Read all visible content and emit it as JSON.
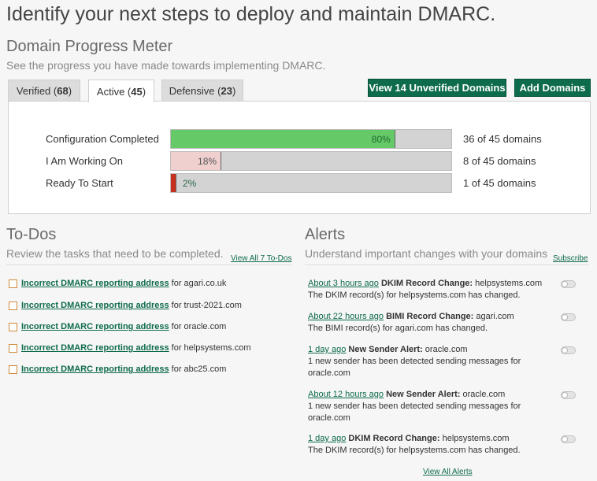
{
  "page_title": "Identify your next steps to deploy and maintain DMARC.",
  "progress_meter": {
    "title": "Domain Progress Meter",
    "subtitle": "See the progress you have made towards implementing DMARC.",
    "tabs": [
      {
        "label": "Verified",
        "count": "68"
      },
      {
        "label": "Active",
        "count": "45"
      },
      {
        "label": "Defensive",
        "count": "23"
      }
    ],
    "active_tab": "Active",
    "view_unverified_button": "View 14 Unverified Domains",
    "add_domains_button": "Add Domains",
    "rows": [
      {
        "label": "Configuration Completed",
        "percent": 80,
        "percent_label": "80%",
        "count": "36 of 45 domains",
        "color": "#66c968"
      },
      {
        "label": "I Am Working On",
        "percent": 18,
        "percent_label": "18%",
        "count": "8 of 45 domains",
        "color": "#f0cfcf"
      },
      {
        "label": "Ready To Start",
        "percent": 2,
        "percent_label": "2%",
        "count": "1 of 45 domains",
        "color": "#c6301f"
      }
    ]
  },
  "todos": {
    "title": "To-Dos",
    "subtitle": "Review the tasks that need to be completed.",
    "view_all_link": "View All 7 To-Dos",
    "items": [
      {
        "link": "Incorrect DMARC reporting address",
        "text": "for agari.co.uk"
      },
      {
        "link": "Incorrect DMARC reporting address",
        "text": "for trust-2021.com"
      },
      {
        "link": "Incorrect DMARC reporting address",
        "text": "for oracle.com"
      },
      {
        "link": "Incorrect DMARC reporting address",
        "text": "for helpsystems.com"
      },
      {
        "link": "Incorrect DMARC reporting address",
        "text": "for abc25.com"
      }
    ]
  },
  "alerts": {
    "title": "Alerts",
    "subtitle": "Understand important changes with your domains",
    "subscribe_link": "Subscribe",
    "view_all_link": "View All Alerts",
    "items": [
      {
        "time": "About 3 hours ago",
        "type": "DKIM Record Change:",
        "domain": "helpsystems.com",
        "line1": "The DKIM record(s) for helpsystems.com has changed.",
        "line2": ""
      },
      {
        "time": "About 22 hours ago",
        "type": "BIMI Record Change:",
        "domain": "agari.com",
        "line1": "The BIMI record(s) for agari.com has changed.",
        "line2": ""
      },
      {
        "time": "1 day ago",
        "type": "New Sender Alert:",
        "domain": "oracle.com",
        "line1": "1 new sender has been detected sending messages for",
        "line2": "oracle.com"
      },
      {
        "time": "About 12 hours ago",
        "type": "New Sender Alert:",
        "domain": "oracle.com",
        "line1": "1 new sender has been detected sending messages for",
        "line2": "oracle.com"
      },
      {
        "time": "1 day ago",
        "type": "DKIM Record Change:",
        "domain": "helpsystems.com",
        "line1": "The DKIM record(s) for helpsystems.com has changed.",
        "line2": ""
      }
    ]
  }
}
